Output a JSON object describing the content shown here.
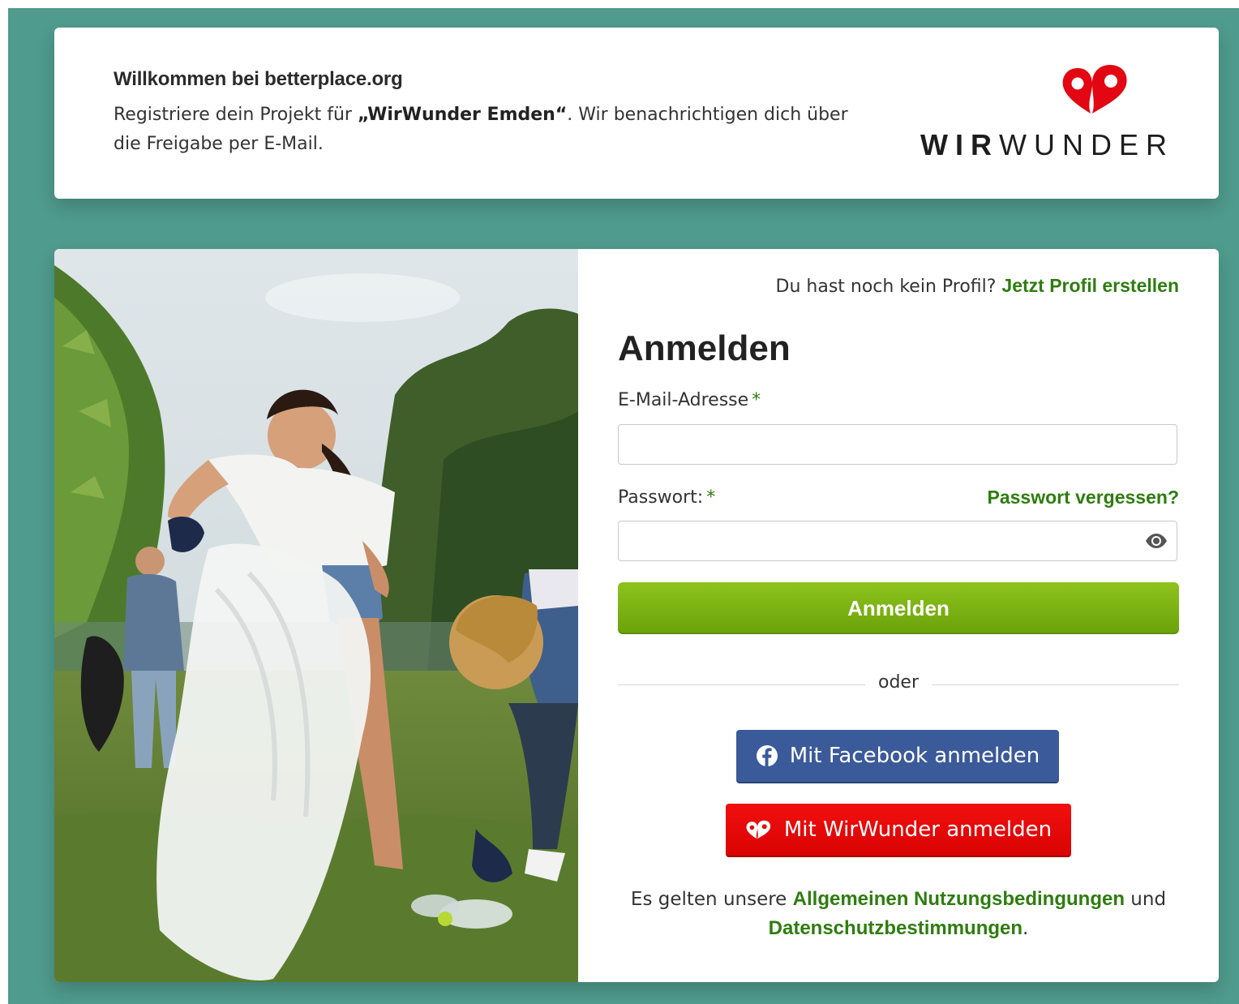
{
  "header": {
    "title": "Willkommen bei betterplace.org",
    "text_before": "Registriere dein Projekt für ",
    "project_name": "„WirWunder Emden“",
    "text_after": ". Wir benachrichtigen dich über die Freigabe per E-Mail.",
    "brand_bold": "WIR",
    "brand_light": "WUNDER"
  },
  "login": {
    "no_profile_text": "Du hast noch kein Profil?",
    "create_profile_link": "Jetzt Profil erstellen",
    "title": "Anmelden",
    "email_label": "E-Mail-Adresse",
    "required_mark": "*",
    "email_value": "",
    "password_label": "Passwort:",
    "forgot_link": "Passwort vergessen?",
    "password_value": "",
    "submit_label": "Anmelden",
    "divider_text": "oder",
    "facebook_button": "Mit Facebook anmelden",
    "wirwunder_button": "Mit WirWunder anmelden",
    "terms_prefix": "Es gelten unsere",
    "terms_link": "Allgemeinen Nutzungsbedingungen",
    "terms_and": "und",
    "privacy_link": "Datenschutzbestimmungen",
    "terms_suffix": "."
  },
  "icons": {
    "brand": "wirwunder-heart-logo",
    "password_toggle": "eye-icon",
    "facebook": "facebook-icon",
    "wirwunder": "wirwunder-icon"
  },
  "colors": {
    "background": "#4f9b8d",
    "link_green": "#2e7d0f",
    "submit_green": "#7bb314",
    "facebook_blue": "#3b5a9a",
    "wirwunder_red": "#e60909"
  }
}
